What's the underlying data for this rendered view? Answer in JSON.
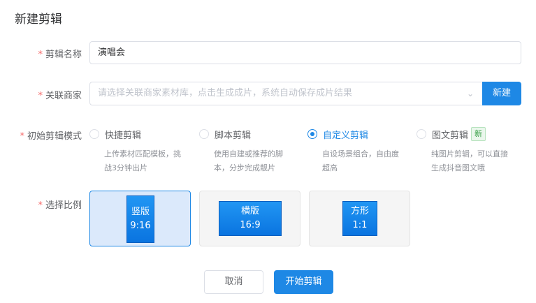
{
  "dialog": {
    "title": "新建剪辑"
  },
  "form": {
    "clip_name": {
      "label": "剪辑名称",
      "value": "演唱会"
    },
    "merchant": {
      "label": "关联商家",
      "placeholder": "请选择关联商家素材库，点击生成成片，系统自动保存成片结果",
      "new_button": "新建"
    },
    "mode": {
      "label": "初始剪辑模式",
      "options": [
        {
          "name": "快捷剪辑",
          "desc_line1": "上传素材匹配模板，挑",
          "desc_line2": "战3分钟出片",
          "selected": false
        },
        {
          "name": "脚本剪辑",
          "desc_line1": "使用自建或推荐的脚",
          "desc_line2": "本，分步完成靓片",
          "selected": false
        },
        {
          "name": "自定义剪辑",
          "desc_line1": "自设场景组合，自由度",
          "desc_line2": "超高",
          "selected": true
        },
        {
          "name": "图文剪辑",
          "badge": "新",
          "desc_line1": "纯图片剪辑，可以直接",
          "desc_line2": "生成抖音图文哦",
          "selected": false
        }
      ]
    },
    "ratio": {
      "label": "选择比例",
      "options": [
        {
          "name": "竖版",
          "ratio": "9:16",
          "selected": true
        },
        {
          "name": "横版",
          "ratio": "16:9",
          "selected": false
        },
        {
          "name": "方形",
          "ratio": "1:1",
          "selected": false
        }
      ]
    }
  },
  "footer": {
    "cancel": "取消",
    "start": "开始剪辑"
  },
  "colors": {
    "accent": "#1e88e5",
    "required": "#f56c6c",
    "badge_green": "#2e9a3e"
  }
}
